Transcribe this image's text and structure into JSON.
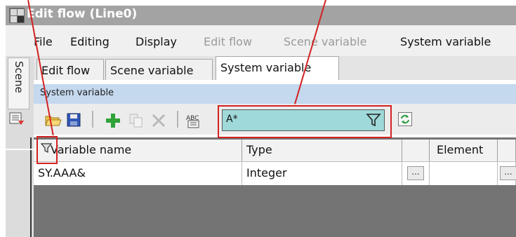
{
  "window": {
    "title": "Edit flow (Line0)"
  },
  "menu": {
    "items": [
      {
        "label": "File",
        "enabled": true
      },
      {
        "label": "Editing",
        "enabled": true
      },
      {
        "label": "Display",
        "enabled": true
      },
      {
        "label": "Edit flow",
        "enabled": false
      },
      {
        "label": "Scene variable",
        "enabled": false
      },
      {
        "label": "System variable",
        "enabled": true
      }
    ]
  },
  "side_tab": {
    "label": "Scene"
  },
  "tabs": [
    {
      "label": "Edit flow",
      "active": false
    },
    {
      "label": "Scene variable",
      "active": false
    },
    {
      "label": "System variable",
      "active": true
    }
  ],
  "panel": {
    "title": "System variable"
  },
  "toolbar": {
    "icons": [
      "open-folder-icon",
      "save-icon",
      "add-icon",
      "copy-icon",
      "delete-icon",
      "rename-icon"
    ],
    "filter": {
      "value": "A*",
      "icon": "funnel-icon"
    },
    "refresh_icon": "refresh-icon"
  },
  "grid": {
    "columns": [
      "Variable name",
      "Type",
      "",
      "Element",
      ""
    ],
    "rows": [
      {
        "name": "SY.AAA&",
        "type": "Integer",
        "button": "...",
        "element": "",
        "button2": "..."
      }
    ]
  },
  "colors": {
    "annotation": "#d32222",
    "filter_bg": "#9fd9d9",
    "panel_header": "#c4d8ee"
  }
}
